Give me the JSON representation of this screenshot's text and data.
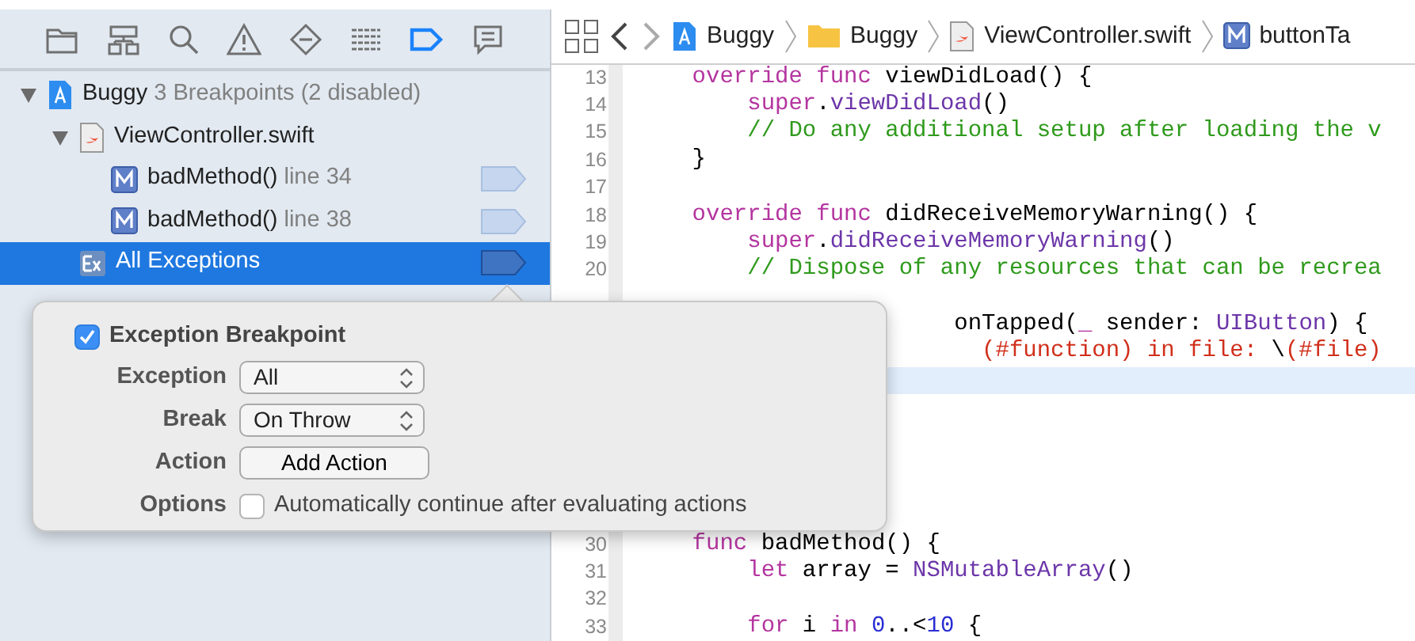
{
  "navigator": {
    "tabs": [
      {
        "kind": "folder",
        "selected": false
      },
      {
        "kind": "hierarchy",
        "selected": false
      },
      {
        "kind": "search",
        "selected": false
      },
      {
        "kind": "warning",
        "selected": false
      },
      {
        "kind": "test",
        "selected": false
      },
      {
        "kind": "debug",
        "selected": false
      },
      {
        "kind": "breakpoint",
        "selected": true
      },
      {
        "kind": "report",
        "selected": false
      }
    ]
  },
  "tree": [
    {
      "kind": "project",
      "name": "Buggy",
      "detail": "3 Breakpoints (2 disabled)",
      "expanded": true,
      "selected": false,
      "children": [
        {
          "kind": "file",
          "name": "ViewController.swift",
          "expanded": true,
          "selected": false,
          "children": [
            {
              "kind": "method",
              "name": "badMethod()",
              "detail": "line 34",
              "enabled": false,
              "selected": false
            },
            {
              "kind": "method",
              "name": "badMethod()",
              "detail": "line 38",
              "enabled": false,
              "selected": false
            }
          ]
        },
        {
          "kind": "exception",
          "name": "All Exceptions",
          "enabled": true,
          "selected": true
        }
      ]
    }
  ],
  "jump_bar": {
    "items": [
      {
        "kind": "project",
        "label": "Buggy"
      },
      {
        "kind": "folder",
        "label": "Buggy"
      },
      {
        "kind": "swift",
        "label": "ViewController.swift"
      },
      {
        "kind": "method",
        "label": "buttonTa"
      }
    ]
  },
  "code": {
    "lines": [
      {
        "num": "13",
        "current": false,
        "segments": [
          {
            "t": "    override func",
            "kind": "keyword"
          },
          {
            "t": " viewDidLoad() {",
            "kind": "plain"
          }
        ]
      },
      {
        "num": "14",
        "current": false,
        "segments": [
          {
            "t": "        super",
            "kind": "keyword"
          },
          {
            "t": ".",
            "kind": "plain"
          },
          {
            "t": "viewDidLoad",
            "kind": "call"
          },
          {
            "t": "()",
            "kind": "plain"
          }
        ]
      },
      {
        "num": "15",
        "current": false,
        "segments": [
          {
            "t": "        // Do any additional setup after loading the v",
            "kind": "comment"
          }
        ]
      },
      {
        "num": "16",
        "current": false,
        "segments": [
          {
            "t": "    }",
            "kind": "plain"
          }
        ]
      },
      {
        "num": "17",
        "current": false
      },
      {
        "num": "18",
        "current": false,
        "segments": [
          {
            "t": "    override func",
            "kind": "keyword"
          },
          {
            "t": " didReceiveMemoryWarning() {",
            "kind": "plain"
          }
        ]
      },
      {
        "num": "19",
        "current": false,
        "segments": [
          {
            "t": "        super",
            "kind": "keyword"
          },
          {
            "t": ".",
            "kind": "plain"
          },
          {
            "t": "didReceiveMemoryWarning",
            "kind": "call"
          },
          {
            "t": "()",
            "kind": "plain"
          }
        ]
      },
      {
        "num": "20",
        "current": false,
        "segments": [
          {
            "t": "        // Dispose of any resources that can be recrea",
            "kind": "comment"
          }
        ]
      },
      {
        "current": false
      },
      {
        "current": false,
        "segments": [
          {
            "t": "                       onTapped(",
            "kind": "plain"
          },
          {
            "t": "_",
            "kind": "keyword"
          },
          {
            "t": " sender: ",
            "kind": "plain"
          },
          {
            "t": "UIButton",
            "kind": "call"
          },
          {
            "t": ") {",
            "kind": "plain"
          }
        ]
      },
      {
        "current": false,
        "segments": [
          {
            "t": "                         (#function) in file: ",
            "kind": "string"
          },
          {
            "t": "\\",
            "kind": "plain"
          },
          {
            "t": "(#file)",
            "kind": "string"
          }
        ]
      },
      {
        "current": true
      },
      {
        "current": false
      },
      {
        "current": false
      },
      {
        "current": false
      },
      {
        "current": false
      },
      {
        "current": false
      },
      {
        "num": "30",
        "current": false,
        "segments": [
          {
            "t": "    func",
            "kind": "keyword"
          },
          {
            "t": " badMethod() {",
            "kind": "plain"
          }
        ]
      },
      {
        "num": "31",
        "current": false,
        "segments": [
          {
            "t": "        let",
            "kind": "keyword"
          },
          {
            "t": " array = ",
            "kind": "plain"
          },
          {
            "t": "NSMutableArray",
            "kind": "call"
          },
          {
            "t": "()",
            "kind": "plain"
          }
        ]
      },
      {
        "num": "32",
        "current": false
      },
      {
        "num": "33",
        "current": false,
        "segments": [
          {
            "t": "        for",
            "kind": "keyword"
          },
          {
            "t": " i ",
            "kind": "plain"
          },
          {
            "t": "in ",
            "kind": "keyword"
          },
          {
            "t": "0",
            "kind": "number"
          },
          {
            "t": "..<",
            "kind": "plain"
          },
          {
            "t": "10",
            "kind": "number"
          },
          {
            "t": " {",
            "kind": "plain"
          }
        ]
      }
    ]
  },
  "popover": {
    "title": "Exception Breakpoint",
    "enabled": true,
    "fields": [
      {
        "kind": "select",
        "label": "Exception",
        "value": "All"
      },
      {
        "kind": "select",
        "label": "Break",
        "value": "On Throw"
      },
      {
        "kind": "button",
        "label": "Action",
        "value": "Add Action"
      },
      {
        "kind": "checkbox",
        "label": "Options",
        "text": "Automatically continue after evaluating actions",
        "checked": false
      }
    ]
  }
}
